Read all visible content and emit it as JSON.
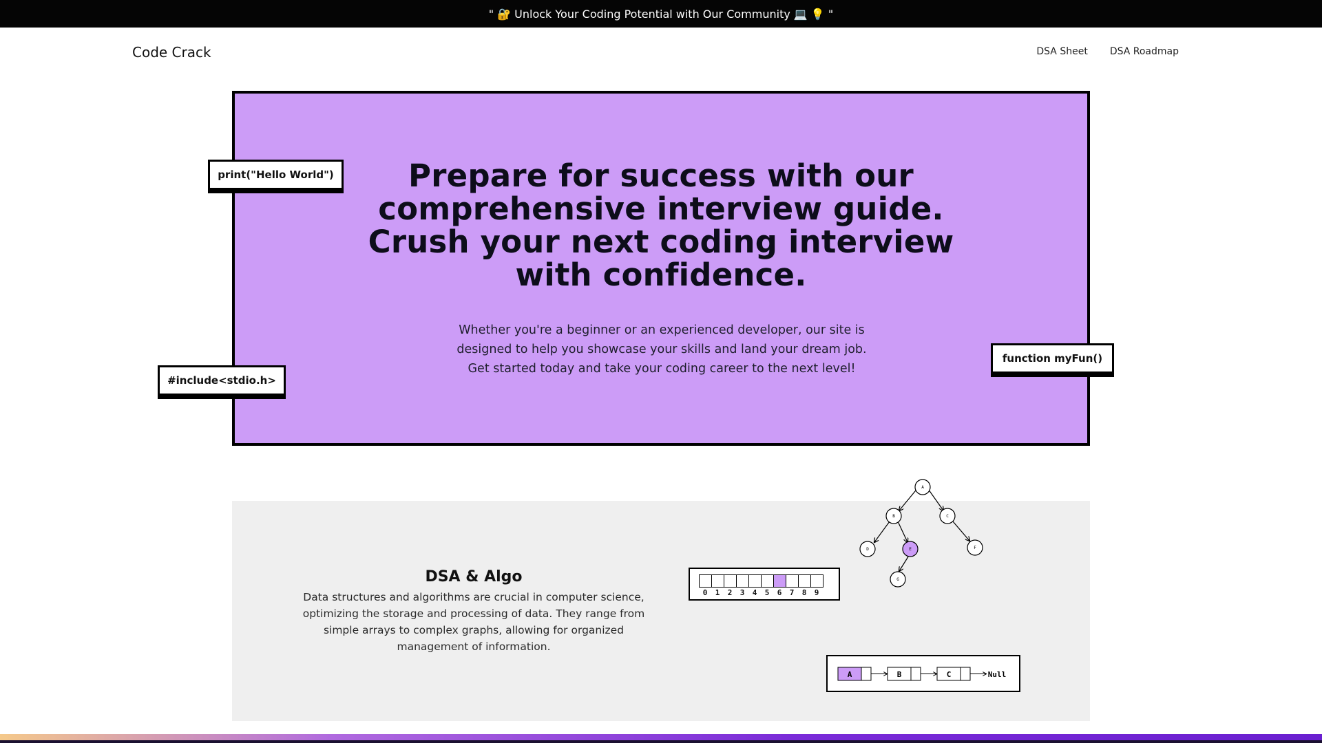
{
  "announcement": "\" 🔐 Unlock Your Coding Potential with Our Community 💻 💡 \"",
  "brand": "Code Crack",
  "nav": {
    "items": [
      "DSA Sheet",
      "DSA Roadmap"
    ]
  },
  "hero": {
    "title": "Prepare for success with our comprehensive interview guide. Crush your next coding interview with confidence.",
    "subtitle": "Whether you're a beginner or an experienced developer, our site is designed to help you showcase your skills and land your dream job. Get started today and take your coding career to the next level!",
    "tags": [
      "print(\"Hello World\")",
      "#include<stdio.h>",
      "function myFun()"
    ]
  },
  "dsa": {
    "title": "DSA & Algo",
    "description": "Data structures and algorithms are crucial in computer science, optimizing the storage and processing of data. They range from simple arrays to complex graphs, allowing for organized management of information.",
    "array_indices": [
      "0",
      "1",
      "2",
      "3",
      "4",
      "5",
      "6",
      "7",
      "8",
      "9"
    ],
    "array_highlight_index": 6,
    "tree_nodes": [
      "A",
      "B",
      "C",
      "D",
      "E",
      "F",
      "G"
    ],
    "tree_highlight": "E",
    "linked_list": [
      "A",
      "B",
      "C"
    ],
    "linked_list_end": "Null"
  },
  "colors": {
    "accent": "#cc9cf7",
    "dark": "#050505",
    "card": "#efefef"
  }
}
